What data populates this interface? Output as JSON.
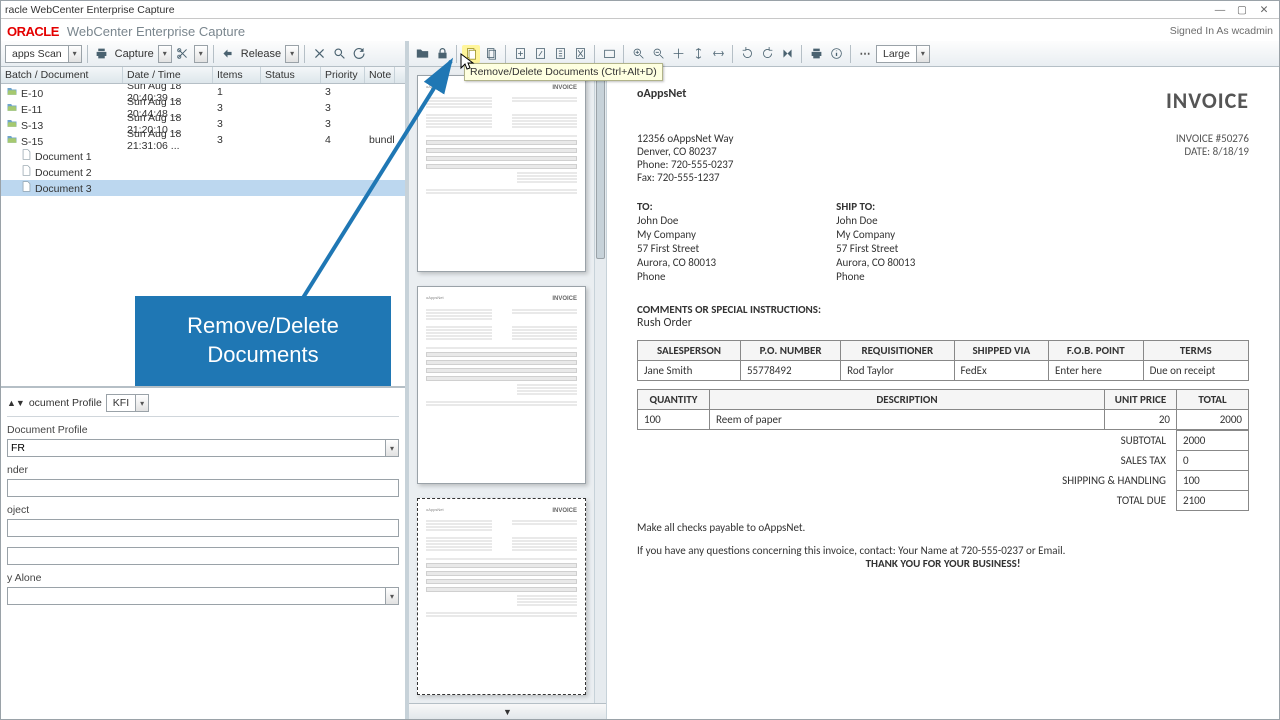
{
  "titlebar": {
    "title": "racle WebCenter Enterprise Capture"
  },
  "header": {
    "logo": "ORACLE",
    "appname": "WebCenter Enterprise Capture",
    "signin": "Signed In As wcadmin"
  },
  "ltool": {
    "scan_label": "apps Scan",
    "capture": "Capture",
    "release": "Release"
  },
  "tree": {
    "headers": {
      "bd": "Batch / Document",
      "dt": "Date / Time",
      "it": "Items",
      "st": "Status",
      "pr": "Priority",
      "no": "Note"
    },
    "batches": [
      {
        "name": "E-10",
        "dt": "Sun Aug 18 20:40:39 ...",
        "items": "1",
        "pri": "3",
        "note": ""
      },
      {
        "name": "E-11",
        "dt": "Sun Aug 18 20:44:48 ...",
        "items": "3",
        "pri": "3",
        "note": ""
      },
      {
        "name": "S-13",
        "dt": "Sun Aug 18 21:20:10 ...",
        "items": "3",
        "pri": "3",
        "note": ""
      },
      {
        "name": "S-15",
        "dt": "Sun Aug 18 21:31:06 ...",
        "items": "3",
        "pri": "4",
        "note": "bundl"
      }
    ],
    "docs": [
      "Document 1",
      "Document 2",
      "Document 3"
    ],
    "selected_doc": 2
  },
  "meta": {
    "profile_label": "ocument Profile",
    "profile_combo": "KFI",
    "section_label": "Document Profile",
    "section_value": "FR",
    "f1_label": "nder",
    "f1_value": "",
    "f2_label": "oject",
    "f2_value": "",
    "f3_label": "",
    "f3_value": "",
    "f4_label": "y Alone",
    "f4_value": ""
  },
  "rtool": {
    "zoom_label": "Large",
    "tooltip": "Remove/Delete Documents (Ctrl+Alt+D)"
  },
  "callout": "Remove/Delete\nDocuments",
  "invoice": {
    "company": "oAppsNet",
    "title": "INVOICE",
    "number_lbl": "INVOICE #50276",
    "date_lbl": "DATE: 8/18/19",
    "from": [
      "12356 oAppsNet Way",
      "Denver, CO 80237",
      "Phone: 720-555-0237",
      "Fax: 720-555-1237"
    ],
    "to_h": "TO:",
    "ship_h": "SHIP TO:",
    "to": [
      "John Doe",
      "My Company",
      "57 First Street",
      "Aurora, CO 80013",
      "Phone"
    ],
    "ship": [
      "John Doe",
      "My Company",
      "57 First Street",
      "Aurora, CO 80013",
      "Phone"
    ],
    "comments_lbl": "COMMENTS OR SPECIAL INSTRUCTIONS:",
    "comments": "Rush Order",
    "head1": [
      "SALESPERSON",
      "P.O. NUMBER",
      "REQUISITIONER",
      "SHIPPED VIA",
      "F.O.B. POINT",
      "TERMS"
    ],
    "row1": [
      "Jane Smith",
      "55778492",
      "Rod Taylor",
      "FedEx",
      "Enter here",
      "Due on receipt"
    ],
    "head2": [
      "QUANTITY",
      "DESCRIPTION",
      "UNIT PRICE",
      "TOTAL"
    ],
    "row2": [
      "100",
      "Reem of paper",
      "20",
      "2000"
    ],
    "totals": [
      {
        "lbl": "SUBTOTAL",
        "val": "2000"
      },
      {
        "lbl": "SALES TAX",
        "val": "0"
      },
      {
        "lbl": "SHIPPING & HANDLING",
        "val": "100"
      },
      {
        "lbl": "TOTAL DUE",
        "val": "2100"
      }
    ],
    "foot1": "Make all checks payable to oAppsNet.",
    "foot2": "If you have any questions concerning this invoice, contact: Your Name at 720-555-0237 or Email.",
    "thanks": "THANK YOU FOR YOUR BUSINESS!"
  },
  "thumbfoot": "▼"
}
